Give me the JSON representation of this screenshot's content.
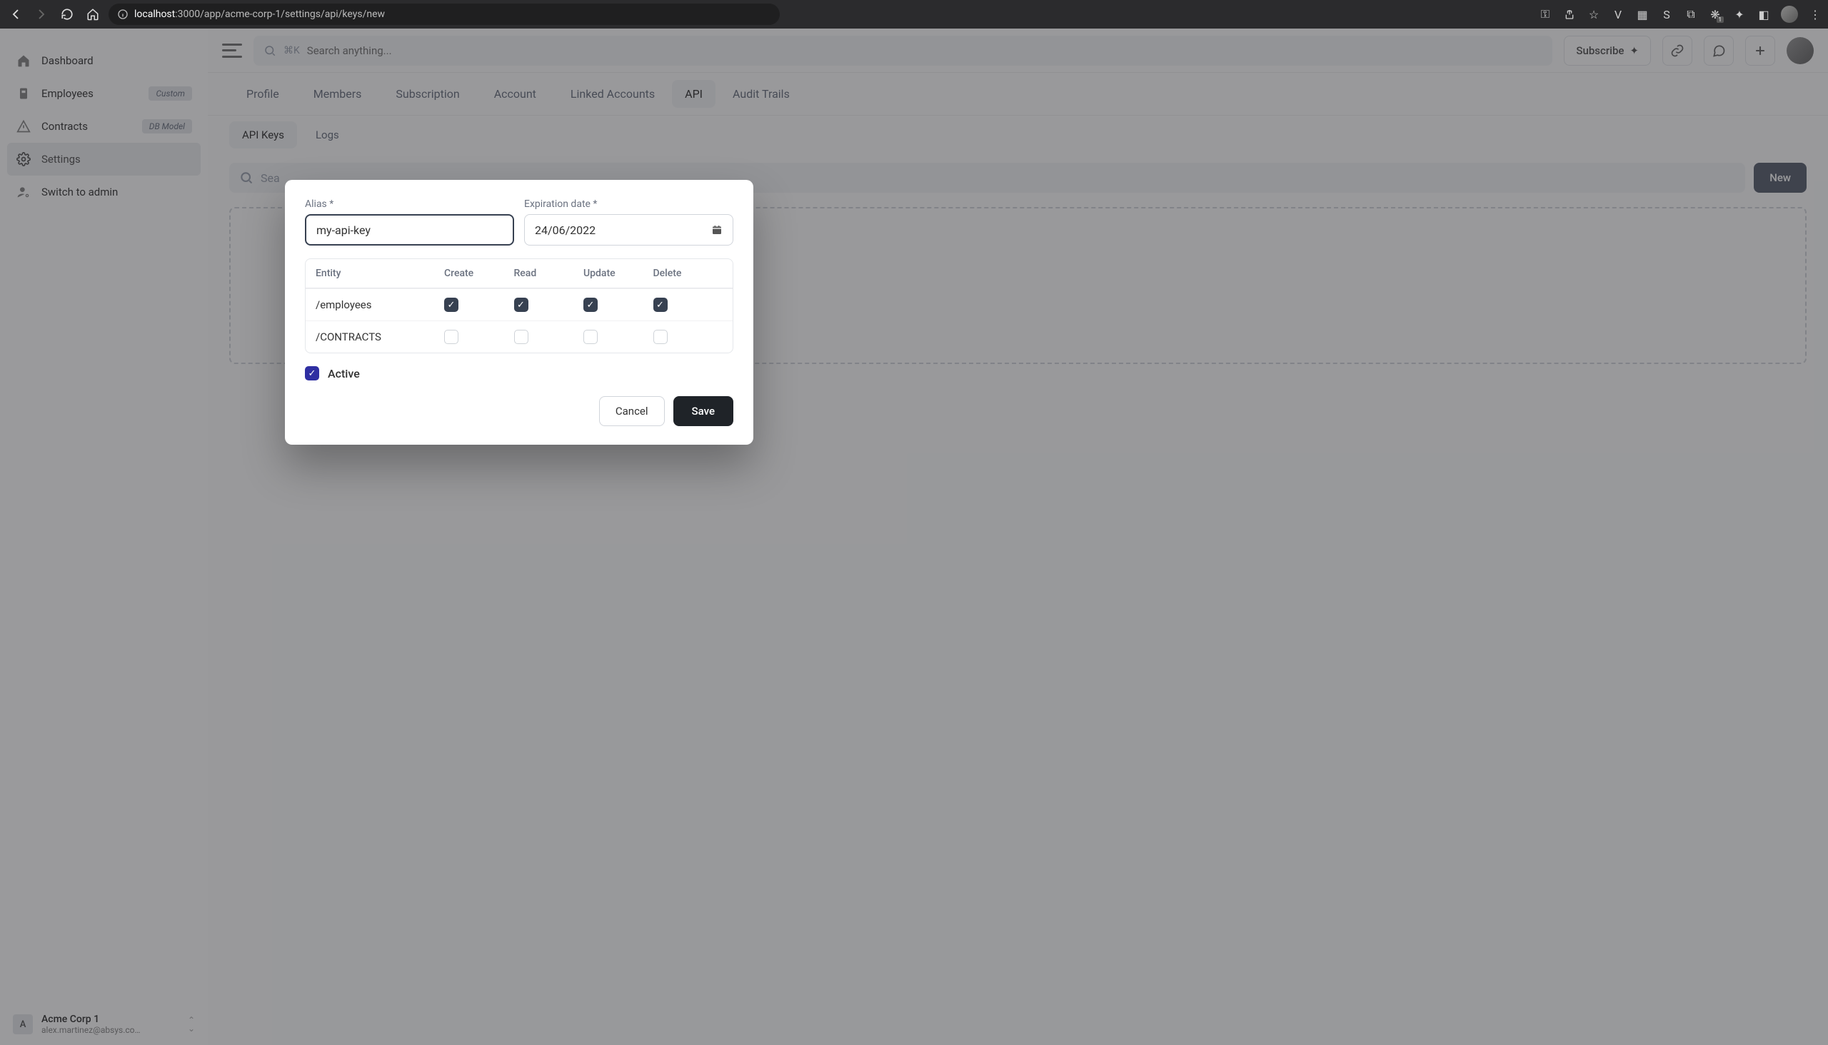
{
  "browser": {
    "url_host": "localhost",
    "url_port": ":3000",
    "url_path": "/app/acme-corp-1/settings/api/keys/new",
    "badge_count": "1"
  },
  "sidebar": {
    "items": [
      {
        "label": "Dashboard",
        "icon": "home"
      },
      {
        "label": "Employees",
        "icon": "id",
        "badge": "Custom"
      },
      {
        "label": "Contracts",
        "icon": "alert",
        "badge": "DB Model"
      },
      {
        "label": "Settings",
        "icon": "gear"
      },
      {
        "label": "Switch to admin",
        "icon": "user-gear"
      }
    ],
    "org": {
      "initial": "A",
      "name": "Acme Corp 1",
      "email": "alex.martinez@absys.co…"
    }
  },
  "topbar": {
    "search_placeholder": "Search anything...",
    "shortcut": "⌘K",
    "subscribe": "Subscribe",
    "subscribe_sparkle": "✦"
  },
  "tabs": [
    "Profile",
    "Members",
    "Subscription",
    "Account",
    "Linked Accounts",
    "API",
    "Audit Trails"
  ],
  "active_tab": "API",
  "subtabs": [
    "API Keys",
    "Logs"
  ],
  "active_subtab": "API Keys",
  "content": {
    "search_placeholder": "Sea",
    "new_button": "New"
  },
  "modal": {
    "alias_label": "Alias *",
    "alias_value": "my-api-key",
    "exp_label": "Expiration date *",
    "exp_value": "24/06/2022",
    "perm_headers": [
      "Entity",
      "Create",
      "Read",
      "Update",
      "Delete"
    ],
    "perm_rows": [
      {
        "entity": "/employees",
        "c": true,
        "r": true,
        "u": true,
        "d": true
      },
      {
        "entity": "/CONTRACTS",
        "c": false,
        "r": false,
        "u": false,
        "d": false
      }
    ],
    "active_label": "Active",
    "active_checked": true,
    "cancel": "Cancel",
    "save": "Save"
  }
}
